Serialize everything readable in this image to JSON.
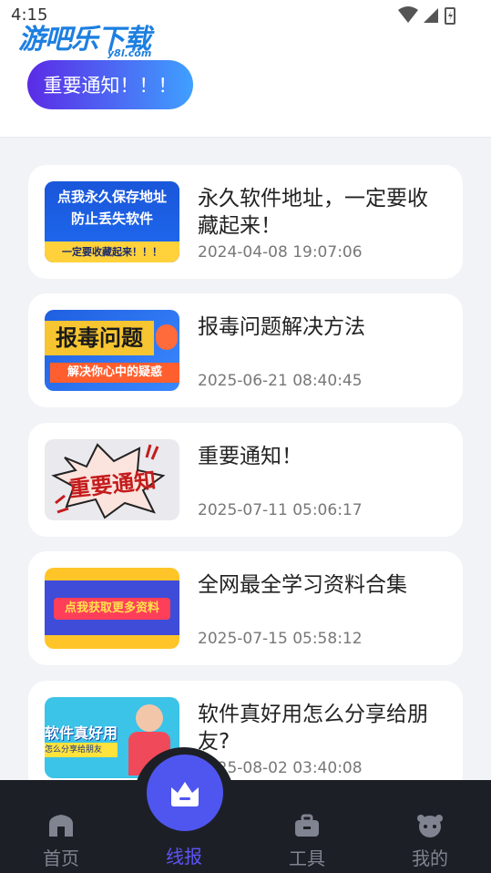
{
  "status": {
    "time": "4:15"
  },
  "brand": {
    "logo_text": "游吧乐下载",
    "logo_sub": "y8l.com"
  },
  "notice_button": "重要通知！！！",
  "articles": [
    {
      "title": "永久软件地址，一定要收藏起来！",
      "date": "2024-04-08 19:07:06",
      "thumb": {
        "line1": "点我永久保存地址",
        "line2": "防止丢失软件",
        "line3": "一定要收藏起来！！！"
      }
    },
    {
      "title": "报毒问题解决方法",
      "date": "2025-06-21 08:40:45",
      "thumb": {
        "line1": "报毒问题",
        "line2": "解决你心中的疑惑"
      }
    },
    {
      "title": "重要通知！",
      "date": "2025-07-11 05:06:17",
      "thumb": {
        "line1": "重要通知"
      }
    },
    {
      "title": "全网最全学习资料合集",
      "date": "2025-07-15 05:58:12",
      "thumb": {
        "line1": "点我获取更多资料"
      }
    },
    {
      "title": "软件真好用怎么分享给朋友?",
      "date": "2025-08-02 03:40:08",
      "thumb": {
        "line1": "软件真好用",
        "line2": "怎么分享给朋友"
      }
    }
  ],
  "tabs": [
    {
      "label": "首页",
      "icon": "home-icon"
    },
    {
      "label": "线报",
      "icon": "news-icon"
    },
    {
      "label": "工具",
      "icon": "toolbox-icon"
    },
    {
      "label": "我的",
      "icon": "profile-icon"
    }
  ],
  "colors": {
    "accent": "#5c55f5",
    "tabbar": "#1d1f26"
  }
}
